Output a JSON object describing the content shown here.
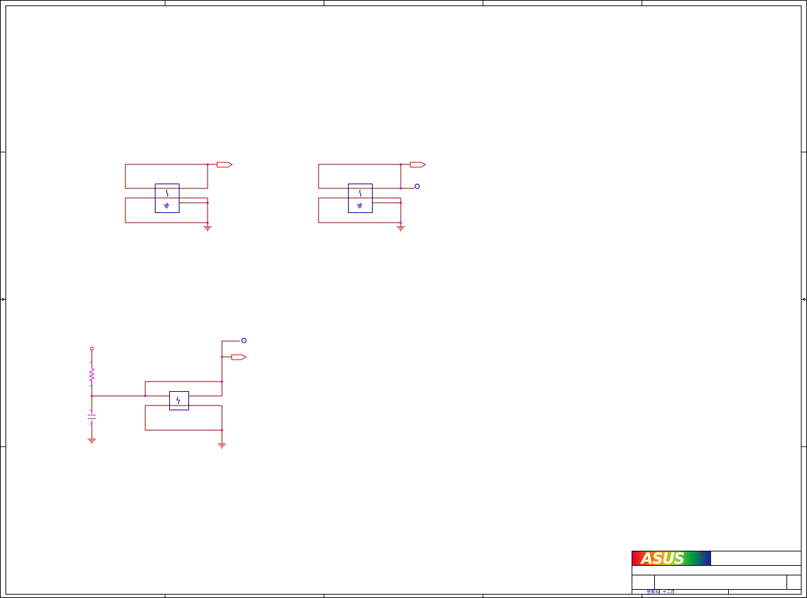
{
  "title_block": {
    "logo_text": "ASUS",
    "registered_mark": "®",
    "footer_cell_1": "星期五",
    "footer_cell_2": "十二月"
  },
  "colors": {
    "frame": "#000000",
    "wire": "#800000",
    "net_port": "#cc0000",
    "component": "#00008b",
    "junction": "#cc00cc",
    "resistor": "#cc00cc"
  },
  "circuits": [
    {
      "name": "circuit-top-left",
      "components": [
        "switch",
        "ground",
        "output-port"
      ]
    },
    {
      "name": "circuit-top-right",
      "components": [
        "switch",
        "ground",
        "output-port",
        "test-point"
      ]
    },
    {
      "name": "circuit-bottom-left",
      "components": [
        "pull-up",
        "resistor",
        "capacitor",
        "switch",
        "ground",
        "output-port",
        "test-point"
      ]
    }
  ]
}
